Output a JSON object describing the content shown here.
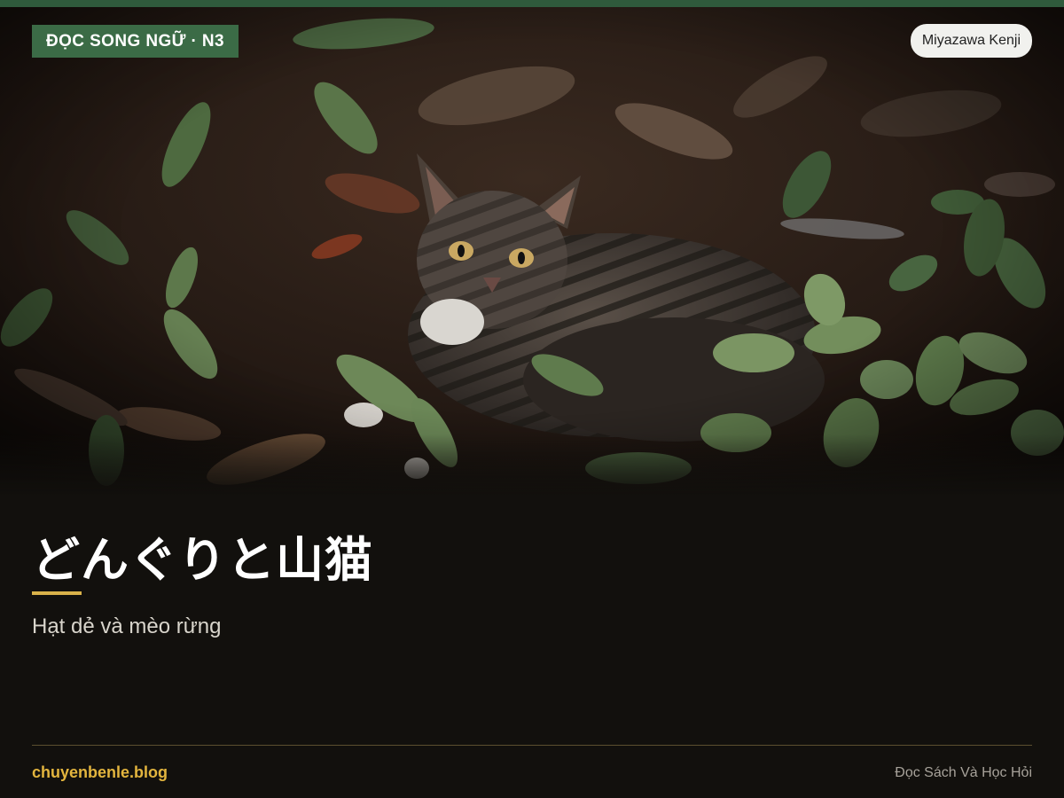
{
  "badge": {
    "label": "ĐỌC SONG NGỮ · N3"
  },
  "author": {
    "name": "Miyazawa Kenji"
  },
  "title": {
    "japanese": "どんぐりと山猫"
  },
  "subtitle": {
    "vietnamese": "Hạt dẻ và mèo rừng"
  },
  "footer": {
    "site": "chuyenbenle.blog",
    "tagline": "Đọc Sách Và Học Hỏi"
  },
  "colors": {
    "accent_green": "#3b6b46",
    "accent_gold": "#e3b53e",
    "background": "#12100d"
  },
  "image": {
    "subject": "tabby-cat-in-leaves"
  }
}
